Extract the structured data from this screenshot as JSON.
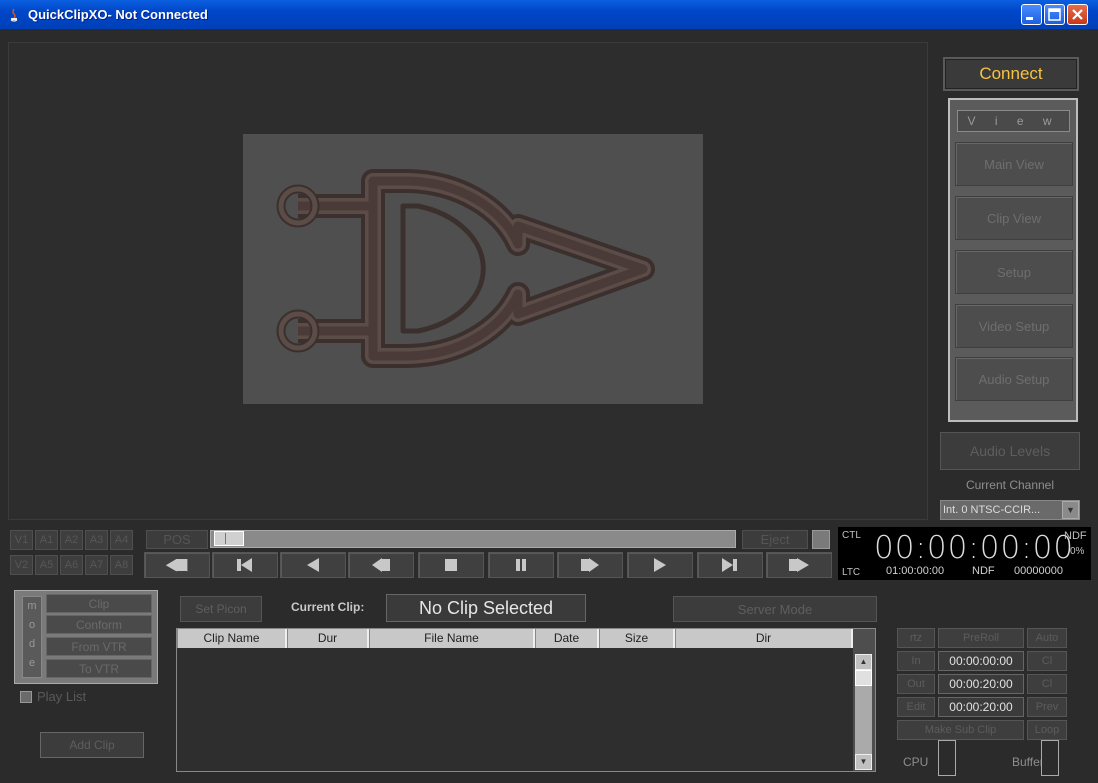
{
  "window": {
    "title": "QuickClipXO- Not Connected"
  },
  "right_panel": {
    "connect_label": "Connect",
    "view_label": "V i e w",
    "view_buttons": [
      "Main View",
      "Clip View",
      "Setup",
      "Video Setup",
      "Audio Setup"
    ],
    "audio_levels_label": "Audio Levels",
    "current_channel_label": "Current Channel",
    "channel_value": "Int. 0 NTSC-CCIR..."
  },
  "tracks": {
    "row1": [
      "V1",
      "A1",
      "A2",
      "A3",
      "A4"
    ],
    "row2": [
      "V2",
      "A5",
      "A6",
      "A7",
      "A8"
    ]
  },
  "transport": {
    "pos_label": "POS",
    "eject_label": "Eject",
    "slider_position": 0.0,
    "buttons": [
      "rewind-icon",
      "skip-to-start-icon",
      "reverse-play-icon",
      "step-back-icon",
      "stop-icon",
      "pause-icon",
      "step-forward-icon",
      "play-icon",
      "skip-to-end-icon",
      "fast-forward-icon"
    ]
  },
  "timecode": {
    "ctl_label": "CTL",
    "ltc_label": "LTC",
    "main": "00:00:00:00",
    "ndf_top": "NDF",
    "percent": "0%",
    "ltc_value": "01:00:00:00",
    "ndf_bottom": "NDF",
    "counter": "00000000"
  },
  "mode": {
    "letters": [
      "m",
      "o",
      "d",
      "e"
    ],
    "buttons": [
      "Clip",
      "Conform",
      "From VTR",
      "To VTR"
    ],
    "playlist_label": "Play List",
    "add_clip_label": "Add Clip"
  },
  "clip": {
    "set_picon_label": "Set Picon",
    "current_clip_label": "Current Clip:",
    "current_clip_value": "No Clip Selected",
    "server_mode_label": "Server Mode"
  },
  "table": {
    "columns": [
      "Clip Name",
      "Dur",
      "File Name",
      "Date",
      "Size",
      "Dir"
    ],
    "rows": []
  },
  "edit": {
    "rtz_label": "rtz",
    "preroll_label": "PreRoll",
    "auto_label": "Auto",
    "in_label": "In",
    "in_value": "00:00:00:00",
    "cl1_label": "Cl",
    "out_label": "Out",
    "out_value": "00:00:20:00",
    "cl2_label": "Cl",
    "edit_label": "Edit",
    "edit_value": "00:00:20:00",
    "prev_label": "Prev",
    "make_sub_clip_label": "Make Sub Clip",
    "loop_label": "Loop",
    "cpu_label": "CPU",
    "buffer_label": "Buffer"
  }
}
